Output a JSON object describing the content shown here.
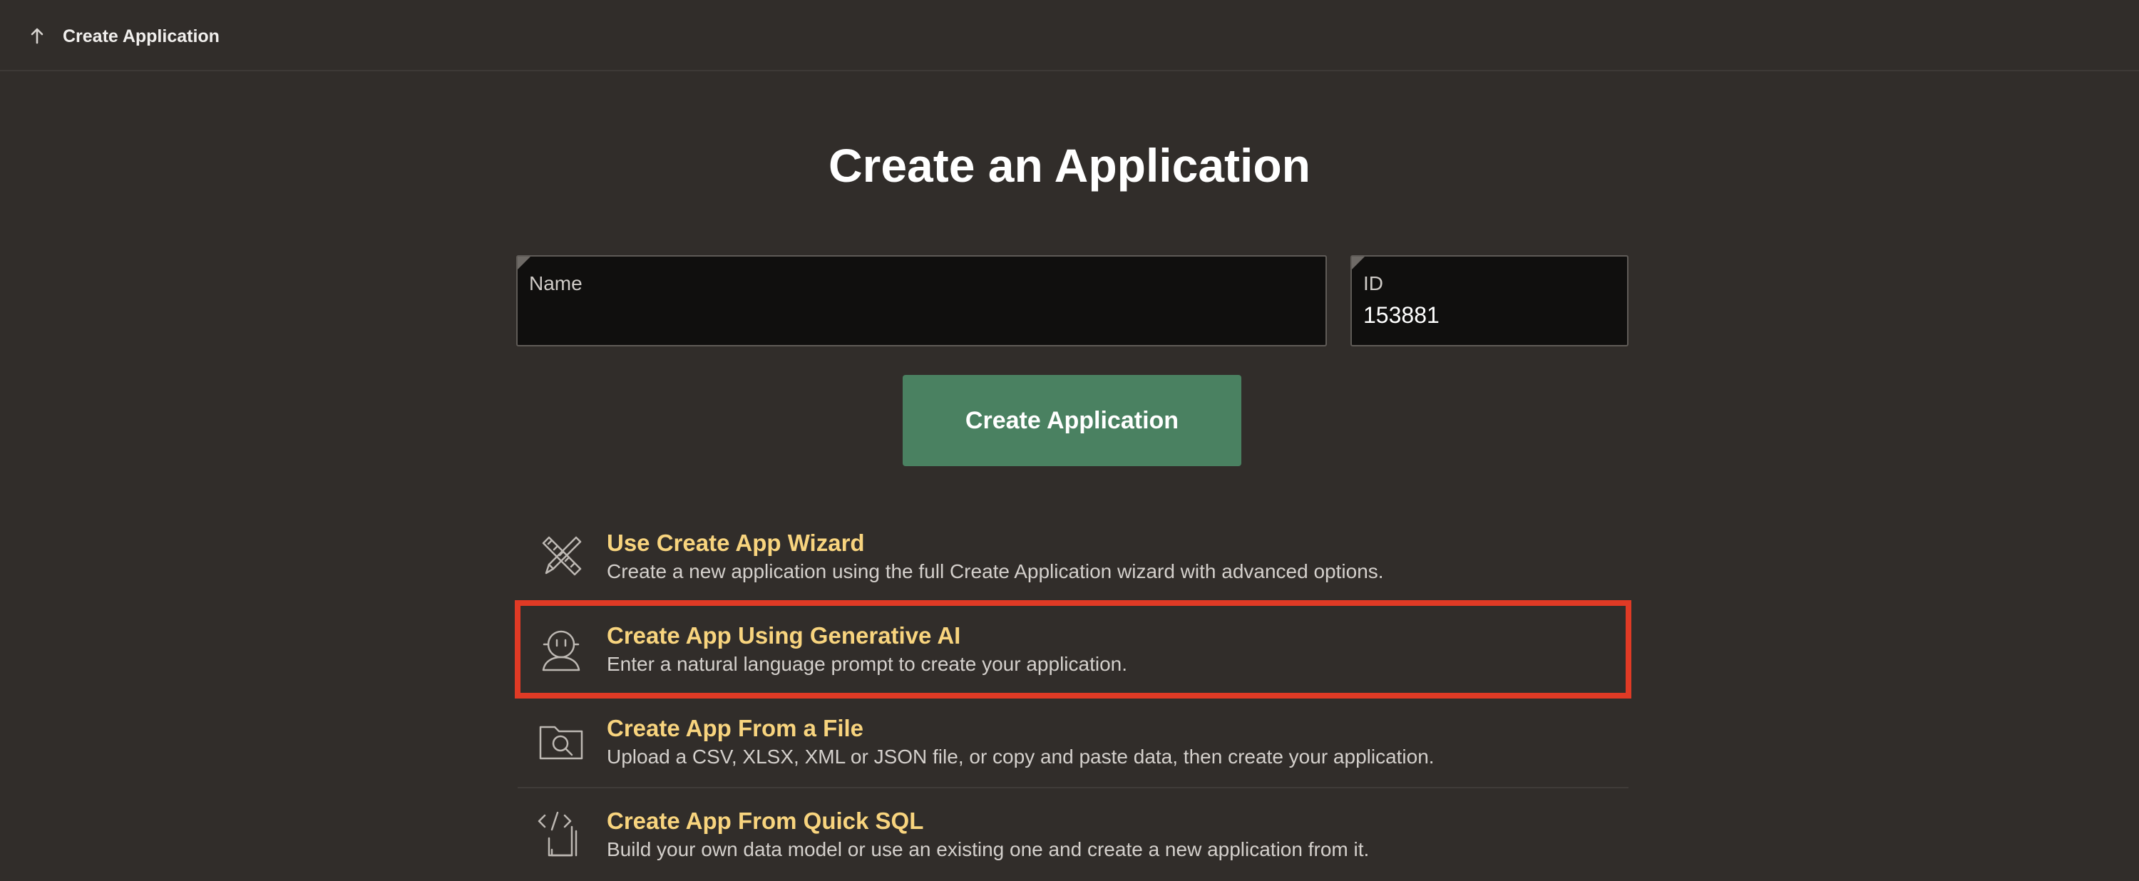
{
  "header": {
    "breadcrumb": "Create Application",
    "icon": "arrow-up-icon"
  },
  "page": {
    "title": "Create an Application"
  },
  "form": {
    "name_label": "Name",
    "name_value": "",
    "id_label": "ID",
    "id_value": "153881",
    "submit_label": "Create Application"
  },
  "options": [
    {
      "icon": "wizard-tools-icon",
      "title": "Use Create App Wizard",
      "description": "Create a new application using the full Create Application wizard with advanced options."
    },
    {
      "icon": "ai-robot-icon",
      "title": "Create App Using Generative AI",
      "description": "Enter a natural language prompt to create your application.",
      "highlighted": true
    },
    {
      "icon": "folder-search-icon",
      "title": "Create App From a File",
      "description": "Upload a CSV, XLSX, XML or JSON file, or copy and paste data, then create your application."
    },
    {
      "icon": "code-file-icon",
      "title": "Create App From Quick SQL",
      "description": "Build your own data model or use an existing one and create a new application from it."
    }
  ],
  "colors": {
    "background": "#312d2a",
    "accent_button": "#4a8161",
    "option_title": "#f8d47e",
    "highlight_border": "#e03a25"
  }
}
